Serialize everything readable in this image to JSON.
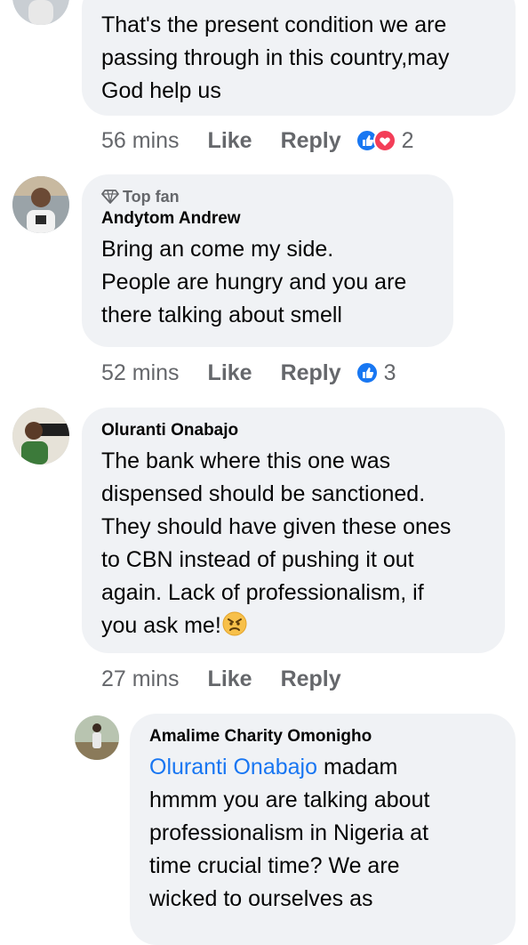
{
  "comments": [
    {
      "text_lines": [
        "That's the present condition we are",
        "passing through in this country,may",
        "God help us"
      ],
      "time": "56 mins",
      "like": "Like",
      "reply": "Reply",
      "reaction_count": "2",
      "reactions": [
        "like-icon",
        "love-icon"
      ]
    },
    {
      "badge": "Top fan",
      "author": "Andytom Andrew",
      "text_lines": [
        "Bring an come my side.",
        "People are hungry and you are",
        "there talking about smell"
      ],
      "time": "52 mins",
      "like": "Like",
      "reply": "Reply",
      "reaction_count": "3",
      "reactions": [
        "like-icon"
      ]
    },
    {
      "author": "Oluranti Onabajo",
      "text_lines": [
        "The bank where this one was",
        "dispensed should be sanctioned.",
        "They should have given these ones",
        "to CBN instead of pushing it out",
        "again. Lack of professionalism, if",
        "you ask me!"
      ],
      "emoji": "angry-face-emoji",
      "time": "27 mins",
      "like": "Like",
      "reply": "Reply"
    },
    {
      "author": "Amalime Charity Omonigho",
      "mention": "Oluranti Onabajo",
      "first_line_rest": " madam",
      "text_lines": [
        "hmmm you are talking about",
        "professionalism in Nigeria at",
        "time crucial time? We are",
        "wicked to ourselves as"
      ]
    }
  ],
  "colors": {
    "bubble": "#f0f2f5",
    "meta": "#65676b",
    "mention": "#1876f2",
    "like_blue": "#1877f2",
    "love_red": "#f33e58"
  }
}
